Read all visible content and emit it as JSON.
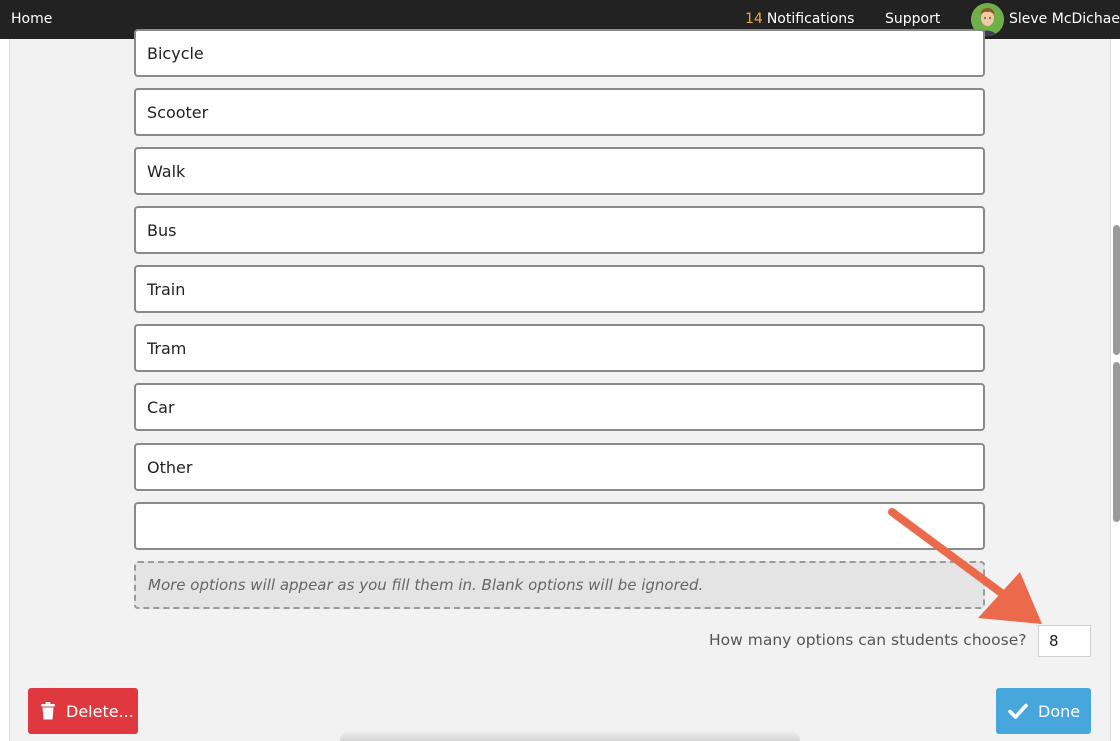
{
  "nav": {
    "home": "Home",
    "notifications_count": "14",
    "notifications_label": "Notifications",
    "support": "Support",
    "user_name": "Sleve McDichael"
  },
  "options": [
    "Bicycle",
    "Scooter",
    "Walk",
    "Bus",
    "Train",
    "Tram",
    "Car",
    "Other",
    ""
  ],
  "hint": "More options will appear as you fill them in. Blank options will be ignored.",
  "choose": {
    "label": "How many options can students choose?",
    "value": "8"
  },
  "buttons": {
    "delete": "Delete...",
    "done": "Done"
  },
  "colors": {
    "delete": "#e0383f",
    "done": "#47a7dd",
    "annotation_arrow": "#eb6a4b",
    "notification_count": "#f0a640"
  },
  "icons": {
    "delete": "trash-icon",
    "done": "check-icon"
  }
}
